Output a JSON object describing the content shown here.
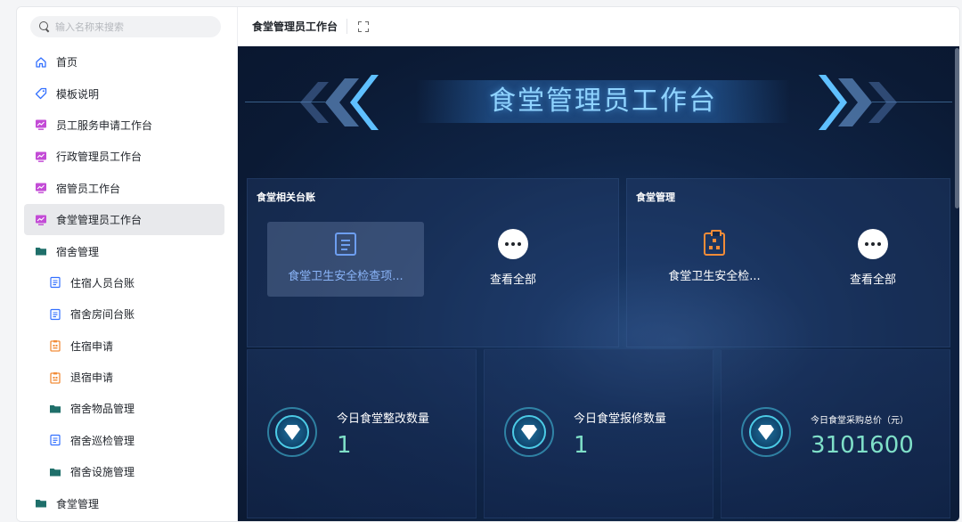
{
  "search": {
    "placeholder": "输入名称来搜索"
  },
  "sidebar": {
    "items": [
      {
        "label": "首页",
        "icon": "home-icon"
      },
      {
        "label": "模板说明",
        "icon": "tag-icon"
      },
      {
        "label": "员工服务申请工作台",
        "icon": "dashboard-icon"
      },
      {
        "label": "行政管理员工作台",
        "icon": "dashboard-icon"
      },
      {
        "label": "宿管员工作台",
        "icon": "dashboard-icon"
      },
      {
        "label": "食堂管理员工作台",
        "icon": "dashboard-icon",
        "active": true
      },
      {
        "label": "宿舍管理",
        "icon": "folder-icon"
      },
      {
        "label": "住宿人员台账",
        "icon": "document-icon"
      },
      {
        "label": "宿舍房间台账",
        "icon": "document-icon"
      },
      {
        "label": "住宿申请",
        "icon": "clipboard-icon"
      },
      {
        "label": "退宿申请",
        "icon": "clipboard-icon"
      },
      {
        "label": "宿舍物品管理",
        "icon": "folder-icon"
      },
      {
        "label": "宿舍巡检管理",
        "icon": "document-icon"
      },
      {
        "label": "宿舍设施管理",
        "icon": "folder-icon"
      },
      {
        "label": "食堂管理",
        "icon": "folder-icon"
      }
    ]
  },
  "header": {
    "tab_title": "食堂管理员工作台"
  },
  "dashboard": {
    "banner_title": "食堂管理员工作台",
    "panel_left": {
      "title": "食堂相关台账",
      "shortcut_label": "食堂卫生安全检查项...",
      "more_label": "查看全部"
    },
    "panel_right": {
      "title": "食堂管理",
      "shortcut_label": "食堂卫生安全检...",
      "more_label": "查看全部"
    },
    "stats": [
      {
        "label": "今日食堂整改数量",
        "value": "1"
      },
      {
        "label": "今日食堂报修数量",
        "value": "1"
      },
      {
        "label": "今日食堂采购总价（元）",
        "value": "3101600"
      }
    ]
  },
  "colors": {
    "accent_blue": "#6d9ef0",
    "accent_orange": "#f28c38",
    "stat_value": "#7fe0c8",
    "banner_text": "#8fd3ff",
    "folder_teal": "#1f6f6a"
  }
}
